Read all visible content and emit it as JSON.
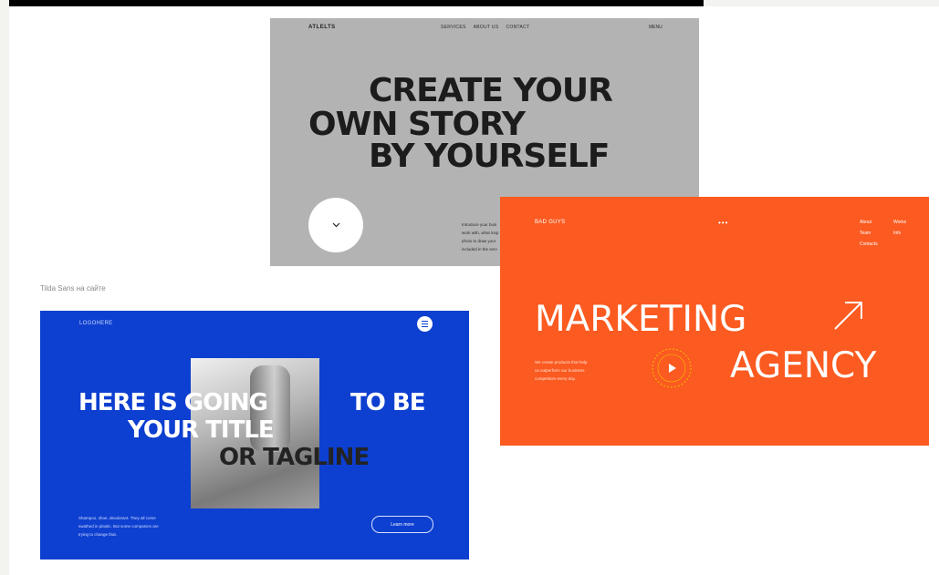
{
  "caption": "Tilda Sans на сайте",
  "gray_card": {
    "logo": "ATLELTS",
    "nav": [
      "SERVICES",
      "ABOUT US",
      "CONTACT"
    ],
    "menu": "MENU",
    "headline_lines": [
      "CREATE YOUR",
      "OWN STORY",
      "BY YOURSELF"
    ],
    "paragraph_lines": [
      "Introduce your busi",
      "work with, what insp",
      "photo to draw your",
      "included in the serv"
    ],
    "scroll_icon": "chevron-down-icon"
  },
  "blue_card": {
    "logo": "LOGOHERE",
    "menu_icon": "hamburger-menu-icon",
    "title_lines": [
      "HERE IS GOING",
      "TO BE",
      "YOUR TITLE"
    ],
    "tagline": "OR TAGLINE",
    "paragraph_lines": [
      "Shampoo, shoe, deodorant. They all come",
      "swathed in plastic. But some companies are",
      "trying to change that."
    ],
    "button_label": "Learn more",
    "accent": "#0d3fd0"
  },
  "orange_card": {
    "logo": "BAD GUYS",
    "dots": "•••",
    "nav_col1": [
      "About",
      "Team",
      "Contacts"
    ],
    "nav_col2": [
      "Works",
      "Info"
    ],
    "headline_line1": "MARKETING",
    "headline_line2": "AGENCY",
    "arrow_icon": "arrow-up-right-icon",
    "paragraph_lines": [
      "We create products that help",
      "us outperform our business",
      "competitors every day."
    ],
    "play_icon": "play-icon",
    "accent": "#fb5a20"
  }
}
